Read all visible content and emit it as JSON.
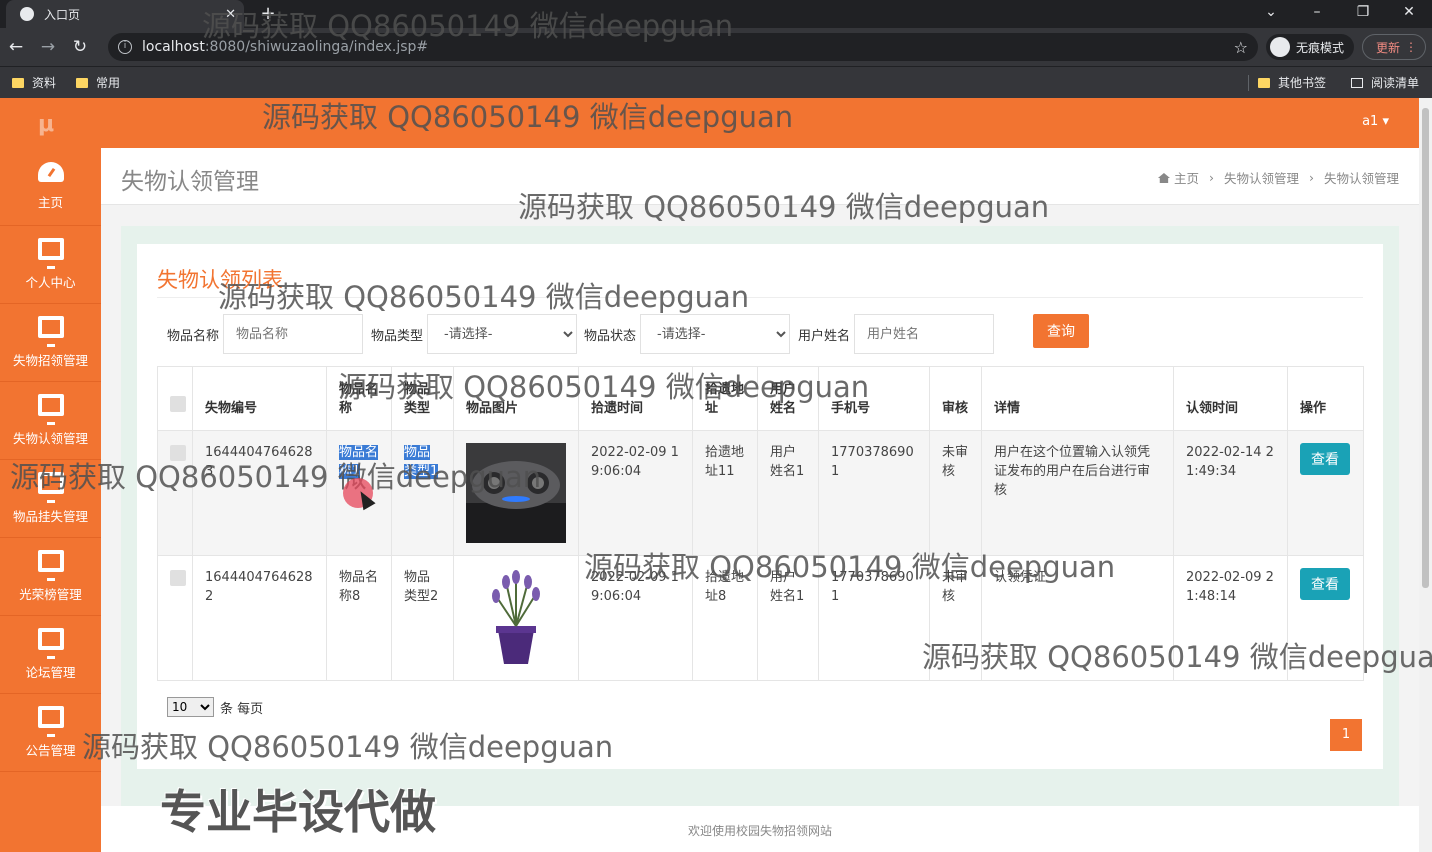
{
  "browser": {
    "tab_title": "入口页",
    "tab_close": "✕",
    "new_tab": "+",
    "url_host": "localhost",
    "url_path": ":8080/shiwuzaolinga/index.jsp#",
    "incognito_label": "无痕模式",
    "update_label": "更新",
    "bookmarks": [
      "资料",
      "常用"
    ],
    "other_bookmarks": "其他书签",
    "reading_list": "阅读清单"
  },
  "app": {
    "logo": "μ",
    "user": "a1 ▾",
    "sidebar": [
      {
        "label": "主页",
        "icon": "dashboard-icon"
      },
      {
        "label": "个人中心",
        "icon": "monitor-icon"
      },
      {
        "label": "失物招领管理",
        "icon": "monitor-icon"
      },
      {
        "label": "失物认领管理",
        "icon": "monitor-icon"
      },
      {
        "label": "物品挂失管理",
        "icon": "monitor-icon"
      },
      {
        "label": "光荣榜管理",
        "icon": "monitor-icon"
      },
      {
        "label": "论坛管理",
        "icon": "monitor-icon"
      },
      {
        "label": "公告管理",
        "icon": "monitor-icon"
      }
    ],
    "page_title": "失物认领管理",
    "breadcrumb": [
      "主页",
      "失物认领管理",
      "失物认领管理"
    ],
    "card_title": "失物认领列表",
    "filters": {
      "name_label": "物品名称",
      "name_placeholder": "物品名称",
      "type_label": "物品类型",
      "type_value": "-请选择-",
      "status_label": "物品状态",
      "status_value": "-请选择-",
      "user_label": "用户姓名",
      "user_placeholder": "用户姓名",
      "query_button": "查询"
    },
    "table": {
      "headers": [
        "失物编号",
        "物品名称",
        "物品类型",
        "物品图片",
        "拾遗时间",
        "拾遗地址",
        "用户姓名",
        "手机号",
        "审核",
        "详情",
        "认领时间",
        "操作"
      ],
      "rows": [
        {
          "id": "16444047646283",
          "name": "物品名称1",
          "type": "物品类型1",
          "time": "2022-02-09 19:06:04",
          "address": "拾遗地址11",
          "user": "用户姓名1",
          "phone": "17703786901",
          "audit": "未审核",
          "detail": "用户在这个位置输入认领凭证发布的用户在后台进行审核",
          "claim_time": "2022-02-14 21:49:34",
          "action": "查看"
        },
        {
          "id": "16444047646282",
          "name": "物品名称8",
          "type": "物品类型2",
          "time": "2022-02-09 19:06:04",
          "address": "拾遗地址8",
          "user": "用户姓名1",
          "phone": "17703786901",
          "audit": "未审核",
          "detail": "认领凭证",
          "claim_time": "2022-02-09 21:48:14",
          "action": "查看"
        }
      ]
    },
    "page_size": "10",
    "page_size_suffix": "条 每页",
    "current_page": "1",
    "footer": "欢迎使用校园失物招领网站"
  },
  "watermarks": {
    "text": "源码获取 QQ86050149 微信deepguan",
    "slogan": "专业毕设代做"
  }
}
